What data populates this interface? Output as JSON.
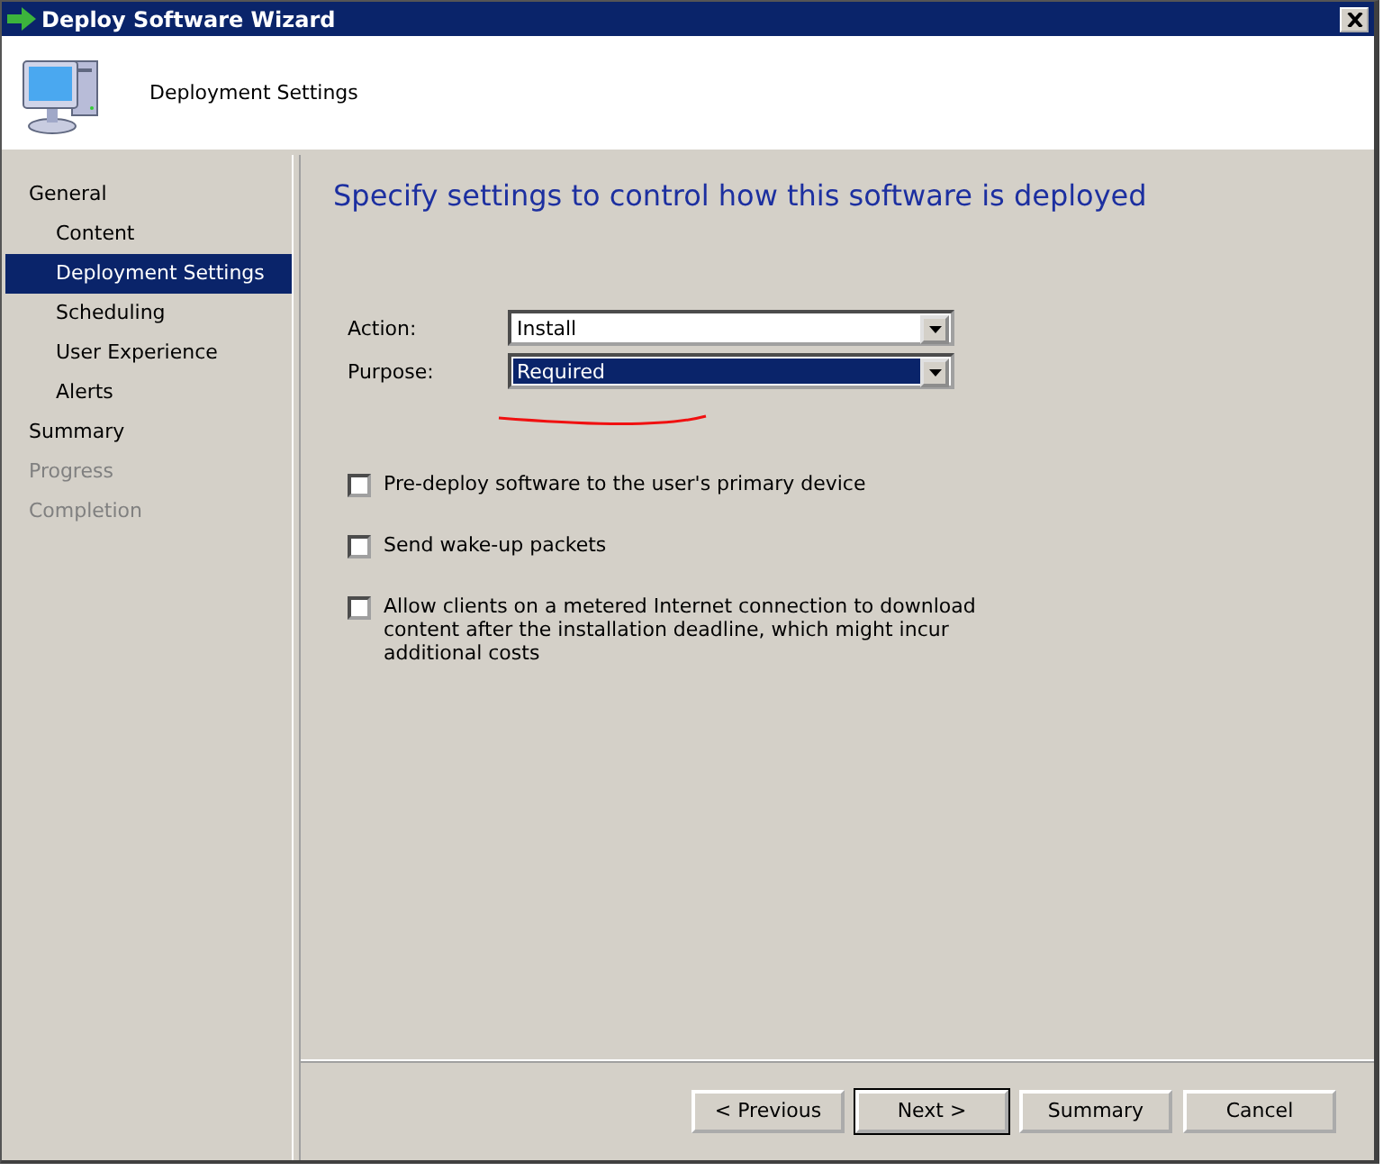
{
  "window": {
    "title": "Deploy Software Wizard"
  },
  "header": {
    "title": "Deployment Settings"
  },
  "sidebar": {
    "items": [
      {
        "label": "General",
        "selected": false,
        "disabled": false,
        "children": [
          {
            "label": "Content",
            "selected": false,
            "disabled": false
          },
          {
            "label": "Deployment Settings",
            "selected": true,
            "disabled": false
          },
          {
            "label": "Scheduling",
            "selected": false,
            "disabled": false
          },
          {
            "label": "User Experience",
            "selected": false,
            "disabled": false
          },
          {
            "label": "Alerts",
            "selected": false,
            "disabled": false
          }
        ]
      },
      {
        "label": "Summary",
        "selected": false,
        "disabled": false
      },
      {
        "label": "Progress",
        "selected": false,
        "disabled": true
      },
      {
        "label": "Completion",
        "selected": false,
        "disabled": true
      }
    ]
  },
  "page": {
    "heading": "Specify settings to control how this software is deployed",
    "fields": [
      {
        "label": "Action:",
        "value": "Install",
        "focused": false
      },
      {
        "label": "Purpose:",
        "value": "Required",
        "focused": true
      }
    ],
    "options": [
      {
        "label": "Pre-deploy software to the user's primary device",
        "checked": false
      },
      {
        "label": "Send wake-up packets",
        "checked": false
      },
      {
        "label": "Allow clients on a metered Internet connection to download content after the installation deadline, which might incur additional costs",
        "checked": false
      }
    ]
  },
  "buttons": [
    {
      "label": "< Previous",
      "default": false
    },
    {
      "label": "Next >",
      "default": true
    },
    {
      "label": "Summary",
      "default": false
    },
    {
      "label": "Cancel",
      "default": false
    }
  ]
}
